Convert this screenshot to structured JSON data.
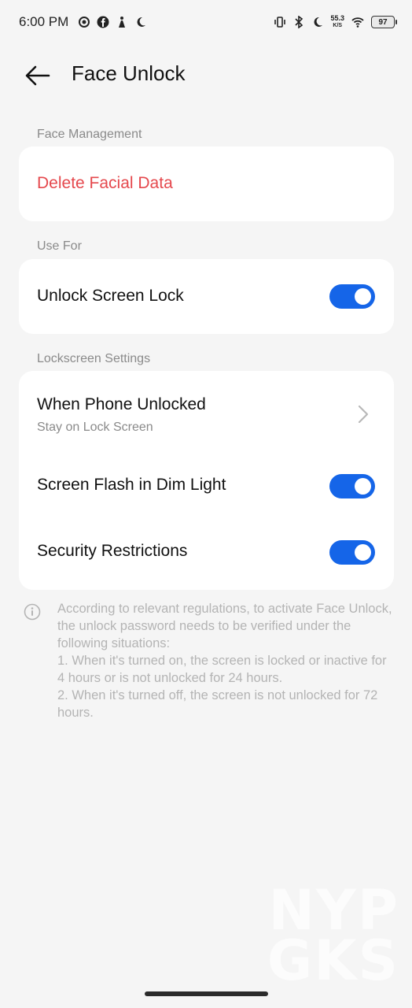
{
  "status_bar": {
    "time": "6:00 PM",
    "left_icons": [
      "location-icon",
      "facebook-icon",
      "figure-icon",
      "moon-icon"
    ],
    "right_icons": [
      "vibrate-icon",
      "bluetooth-icon",
      "moon-icon",
      "wifi-icon"
    ],
    "net_speed": "55.3",
    "net_speed_unit": "K/S",
    "battery": "97"
  },
  "header": {
    "back_icon": "arrow-left-icon",
    "title": "Face Unlock"
  },
  "sections": {
    "face_management": {
      "label": "Face Management",
      "delete_label": "Delete Facial Data",
      "delete_color": "#e5484d"
    },
    "use_for": {
      "label": "Use For",
      "unlock_screen_lock": {
        "label": "Unlock Screen Lock",
        "enabled": true
      }
    },
    "lockscreen": {
      "label": "Lockscreen Settings",
      "when_unlocked": {
        "label": "When Phone Unlocked",
        "value": "Stay on Lock Screen"
      },
      "screen_flash": {
        "label": "Screen Flash in Dim Light",
        "enabled": true
      },
      "security_restrictions": {
        "label": "Security Restrictions",
        "enabled": true
      }
    }
  },
  "info": {
    "icon": "info-icon",
    "intro": "According to relevant regulations, to activate Face Unlock, the unlock password needs to be verified under the following situations:",
    "item1": "1. When it's turned on, the screen is locked or inactive for 4 hours or is not unlocked for 24 hours.",
    "item2": "2. When it's turned off, the screen is not unlocked for 72 hours."
  },
  "watermark": {
    "line1": "NYP",
    "line2": "GKS"
  },
  "colors": {
    "accent": "#1565e8",
    "background": "#f5f5f5",
    "card": "#ffffff"
  }
}
